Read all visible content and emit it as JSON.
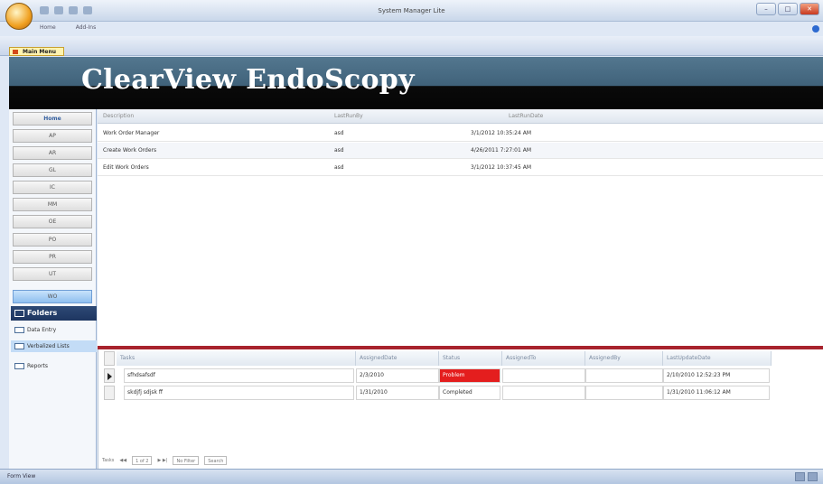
{
  "window": {
    "title": "System Manager Lite",
    "ribbon_tabs": [
      "Home",
      "Add-Ins"
    ]
  },
  "object_tab": {
    "label": "Main Menu"
  },
  "banner": {
    "title": "ClearView EndoScopy"
  },
  "sidebar": {
    "nav_buttons": [
      {
        "label": "Home"
      },
      {
        "label": "AP"
      },
      {
        "label": "AR"
      },
      {
        "label": "GL"
      },
      {
        "label": "IC"
      },
      {
        "label": "MM"
      },
      {
        "label": "OE"
      },
      {
        "label": "PO"
      },
      {
        "label": "PR"
      },
      {
        "label": "UT"
      },
      {
        "label": "WO"
      }
    ],
    "folders_label": "Folders",
    "folder_items": [
      {
        "label": "Data Entry"
      },
      {
        "label": "Verbalized Lists"
      },
      {
        "label": "Reports"
      }
    ]
  },
  "top_table": {
    "headers": [
      "Description",
      "LastRunBy",
      "LastRunDate"
    ],
    "rows": [
      {
        "description": "Work Order Manager",
        "last_run_by": "asd",
        "last_run_date": "3/1/2012 10:35:24 AM"
      },
      {
        "description": "Create Work Orders",
        "last_run_by": "asd",
        "last_run_date": "4/26/2011 7:27:01 AM"
      },
      {
        "description": "Edit Work Orders",
        "last_run_by": "asd",
        "last_run_date": "3/1/2012 10:37:45 AM"
      }
    ]
  },
  "bottom_table": {
    "headers": [
      "Tasks",
      "AssignedDate",
      "Status",
      "AssignedTo",
      "AssignedBy",
      "LastUpdateDate"
    ],
    "rows": [
      {
        "task": "sfhdsafsdf",
        "assigned_date": "2/3/2010",
        "status": "Problem",
        "assigned_to": "",
        "assigned_by": "",
        "last_update_date": "2/10/2010 12:52:23 PM"
      },
      {
        "task": "skdjfj sdjsk ff",
        "assigned_date": "1/31/2010",
        "status": "Completed",
        "assigned_to": "",
        "assigned_by": "",
        "last_update_date": "1/31/2010 11:06:12 AM"
      }
    ]
  },
  "record_nav": {
    "label": "Tasks",
    "position": "1 of 2",
    "filter": "No Filter",
    "search": "Search"
  },
  "status_bar": {
    "text": "Form View"
  },
  "colors": {
    "problem_status": "#e41e1e",
    "divider": "#a8232d",
    "banner_blue": "#4a6e87"
  }
}
